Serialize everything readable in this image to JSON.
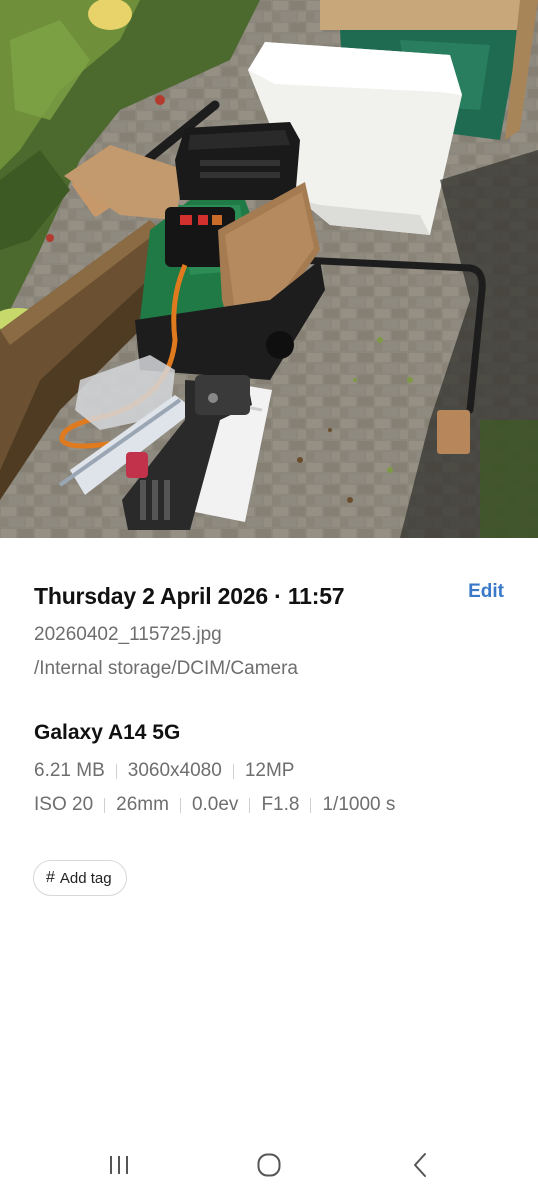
{
  "photo": {
    "subject": "garden shredder"
  },
  "details": {
    "date_time": "Thursday 2 April 2026 · 11:57",
    "edit_label": "Edit",
    "file_name": "20260402_115725.jpg",
    "file_path": "/Internal storage/DCIM/Camera",
    "device": "Galaxy A14 5G",
    "file_size": "6.21 MB",
    "resolution": "3060x4080",
    "megapixels": "12MP",
    "iso": "ISO 20",
    "focal_length": "26mm",
    "exposure_value": "0.0ev",
    "aperture": "F1.8",
    "shutter_speed": "1/1000 s",
    "add_tag_label": "Add tag"
  },
  "navbar": {
    "recents_icon": "recents-icon",
    "home_icon": "home-icon",
    "back_icon": "back-icon"
  },
  "colors": {
    "accent": "#3a79c9",
    "secondary_text": "#6e6e6e",
    "primary_text": "#111111"
  }
}
